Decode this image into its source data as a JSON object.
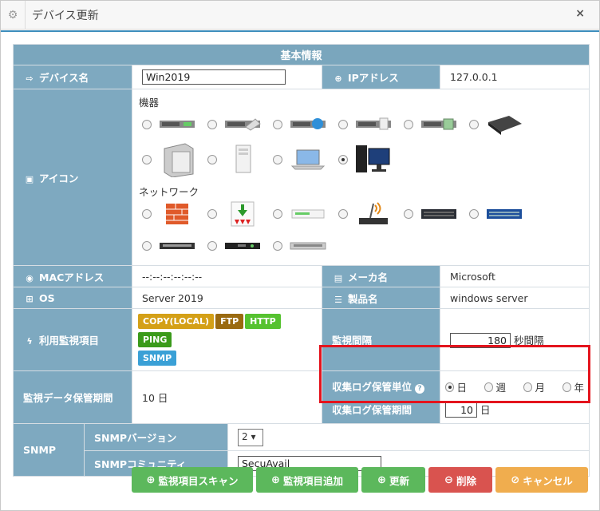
{
  "window": {
    "title": "デバイス更新",
    "gear_icon": "gear-icon",
    "close_glyph": "×"
  },
  "section_header": "基本情報",
  "device": {
    "label": "デバイス名",
    "value": "Win2019"
  },
  "ip": {
    "label": "IPアドレス",
    "value": "127.0.0.1"
  },
  "icon": {
    "label": "アイコン",
    "group_device": "機器",
    "group_network": "ネットワーク",
    "device_icons": [
      "server-rack-1",
      "server-rack-2",
      "server-rack-3",
      "server-rack-4",
      "server-rack-5",
      "server-1u-dark",
      "tower-server-silver",
      "tower-pc-white",
      "laptop",
      "desktop-pc"
    ],
    "network_icons": [
      "firewall",
      "router-download",
      "switch-white",
      "wifi-router",
      "switch-black",
      "switch-blue",
      "patch-panel-1",
      "patch-panel-2",
      "patch-panel-3"
    ],
    "selected_device_index": 9
  },
  "mac": {
    "label": "MACアドレス",
    "value": "--:--:--:--:--:--"
  },
  "maker": {
    "label": "メーカ名",
    "value": "Microsoft"
  },
  "os": {
    "label": "OS",
    "value": "Server 2019"
  },
  "product": {
    "label": "製品名",
    "value": "windows server"
  },
  "monitor_items": {
    "label": "利用監視項目",
    "badges": [
      {
        "text": "COPY(LOCAL)",
        "color": "#d4a017"
      },
      {
        "text": "FTP",
        "color": "#9a6a10"
      },
      {
        "text": "HTTP",
        "color": "#56c230"
      },
      {
        "text": "PING",
        "color": "#3a9a1a"
      },
      {
        "text": "SNMP",
        "color": "#3aa0d6"
      }
    ]
  },
  "interval": {
    "label": "監視間隔",
    "value": "180",
    "unit": "秒間隔"
  },
  "retention": {
    "label": "監視データ保管期間",
    "value": "10 日"
  },
  "log_unit": {
    "label": "収集ログ保管単位",
    "help": "?",
    "options": [
      "日",
      "週",
      "月",
      "年"
    ],
    "selected_index": 0
  },
  "log_period": {
    "label": "収集ログ保管期間",
    "value": "10",
    "unit": "日"
  },
  "snmp": {
    "label": "SNMP",
    "version_label": "SNMPバージョン",
    "version_value": "2",
    "version_arrow": "▾",
    "community_label": "SNMPコミュニティ",
    "community_value": "SecuAvail"
  },
  "buttons": {
    "scan": "監視項目スキャン",
    "add": "監視項目追加",
    "update": "更新",
    "delete": "削除",
    "cancel": "キャンセル"
  },
  "colors": {
    "label_bg": "#7ea9c0",
    "header_bg": "#7aa6bd",
    "green": "#5cb85c",
    "red": "#d9534f",
    "orange": "#f0ad4e",
    "highlight": "#e4141d"
  }
}
